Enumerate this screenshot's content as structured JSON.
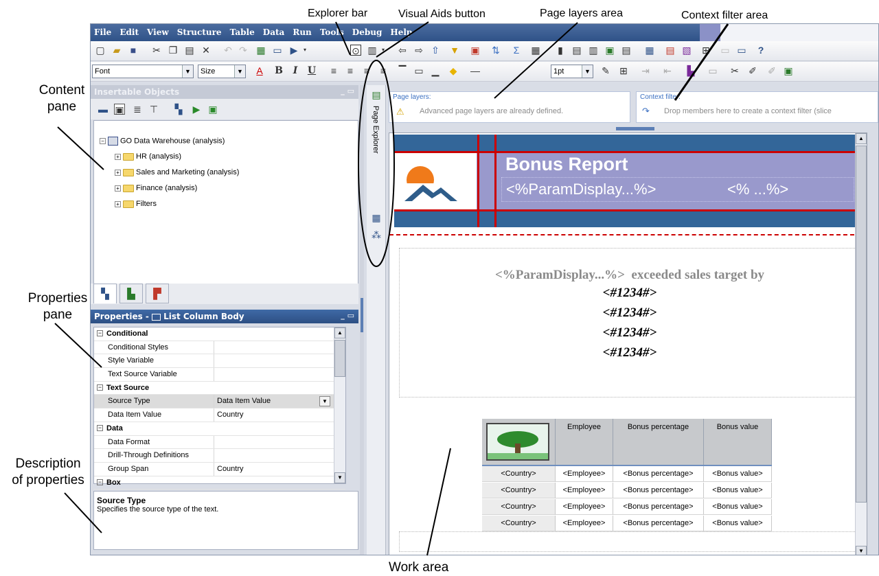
{
  "callouts": {
    "explorer_bar": "Explorer bar",
    "visual_aids_button": "Visual Aids button",
    "page_layers_area": "Page layers area",
    "context_filter_area": "Context filter area",
    "content_pane": "Content\npane",
    "properties_pane": "Properties\npane",
    "description_of_properties": "Description\nof properties",
    "work_area": "Work area"
  },
  "menu": [
    "File",
    "Edit",
    "View",
    "Structure",
    "Table",
    "Data",
    "Run",
    "Tools",
    "Debug",
    "Help"
  ],
  "format_toolbar": {
    "font": "Font",
    "size": "Size",
    "line_width": "1pt"
  },
  "content_pane": {
    "title": "Insertable Objects",
    "tree": {
      "root": "GO Data Warehouse (analysis)",
      "children": [
        "HR (analysis)",
        "Sales and Marketing (analysis)",
        "Finance (analysis)",
        "Filters"
      ]
    }
  },
  "properties_pane": {
    "title": "Properties - ",
    "subject": "List Column Body",
    "rows": [
      {
        "type": "cat",
        "label": "Conditional"
      },
      {
        "type": "prop",
        "label": "Conditional Styles",
        "value": ""
      },
      {
        "type": "prop",
        "label": "Style Variable",
        "value": ""
      },
      {
        "type": "prop",
        "label": "Text Source Variable",
        "value": ""
      },
      {
        "type": "cat",
        "label": "Text Source"
      },
      {
        "type": "prop",
        "label": "Source Type",
        "value": "Data Item Value",
        "selected": true
      },
      {
        "type": "prop",
        "label": "Data Item Value",
        "value": "Country"
      },
      {
        "type": "cat",
        "label": "Data"
      },
      {
        "type": "prop",
        "label": "Data Format",
        "value": ""
      },
      {
        "type": "prop",
        "label": "Drill-Through Definitions",
        "value": ""
      },
      {
        "type": "prop",
        "label": "Group Span",
        "value": "Country"
      },
      {
        "type": "cat",
        "label": "Box"
      }
    ]
  },
  "description": {
    "title": "Source Type",
    "text": "Specifies the source type of the text."
  },
  "explorer_tab": "Page Explorer",
  "page_layers": {
    "label": "Page layers:",
    "message": "Advanced page layers are already defined."
  },
  "context_filter": {
    "label": "Context filter:",
    "message": "Drop members here to create a context filter (slice"
  },
  "report": {
    "title": "Bonus Report",
    "param_display": "<%ParamDisplay...%>",
    "param_short": "<% ...%>",
    "sentence_param": "<%ParamDisplay...%>",
    "sentence_text": "exceeded sales target by",
    "numbers": [
      "<#1234#>",
      "<#1234#>",
      "<#1234#>",
      "<#1234#>"
    ],
    "table": {
      "headers": [
        "Employee",
        "Bonus percentage",
        "Bonus value"
      ],
      "rows": [
        [
          "<Country>",
          "<Employee>",
          "<Bonus percentage>",
          "<Bonus value>"
        ],
        [
          "<Country>",
          "<Employee>",
          "<Bonus percentage>",
          "<Bonus value>"
        ],
        [
          "<Country>",
          "<Employee>",
          "<Bonus percentage>",
          "<Bonus value>"
        ],
        [
          "<Country>",
          "<Employee>",
          "<Bonus percentage>",
          "<Bonus value>"
        ]
      ]
    }
  },
  "colors": {
    "menubar": "#2f5288",
    "banner": "#336699",
    "title_band": "#9999cc",
    "accent_red": "#cc0000"
  }
}
